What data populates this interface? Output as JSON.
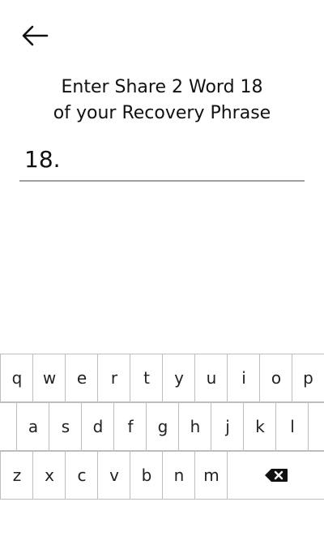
{
  "header": {
    "back_icon": "arrow-left-icon"
  },
  "title": {
    "line1": "Enter Share 2 Word 18",
    "line2": "of your Recovery Phrase"
  },
  "word_input": {
    "prefix": "18.",
    "value": "",
    "placeholder": ""
  },
  "keyboard": {
    "row1": [
      "q",
      "w",
      "e",
      "r",
      "t",
      "y",
      "u",
      "i",
      "o",
      "p"
    ],
    "row2": [
      "a",
      "s",
      "d",
      "f",
      "g",
      "h",
      "j",
      "k",
      "l"
    ],
    "row3": [
      "z",
      "x",
      "c",
      "v",
      "b",
      "n",
      "m"
    ],
    "backspace_icon": "backspace-icon"
  }
}
